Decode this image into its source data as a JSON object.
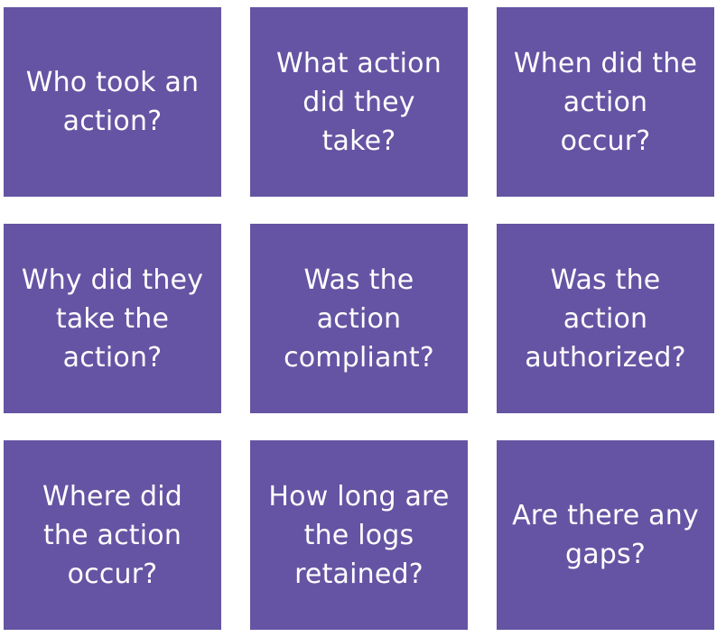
{
  "colors": {
    "tile_background": "#6554a3",
    "tile_text": "#ffffff",
    "page_background": "#ffffff"
  },
  "tiles": [
    {
      "lines": [
        "Who took an",
        "action?"
      ]
    },
    {
      "lines": [
        "What action",
        "did they",
        "take?"
      ]
    },
    {
      "lines": [
        "When did the",
        "action",
        "occur?"
      ]
    },
    {
      "lines": [
        "Why did they",
        "take the",
        "action?"
      ]
    },
    {
      "lines": [
        "Was the",
        "action",
        "compliant?"
      ]
    },
    {
      "lines": [
        "Was the",
        "action",
        "authorized?"
      ]
    },
    {
      "lines": [
        "Where did",
        "the action",
        "occur?"
      ]
    },
    {
      "lines": [
        "How long are",
        "the logs",
        "retained?"
      ]
    },
    {
      "lines": [
        "Are there any",
        "gaps?"
      ]
    }
  ]
}
